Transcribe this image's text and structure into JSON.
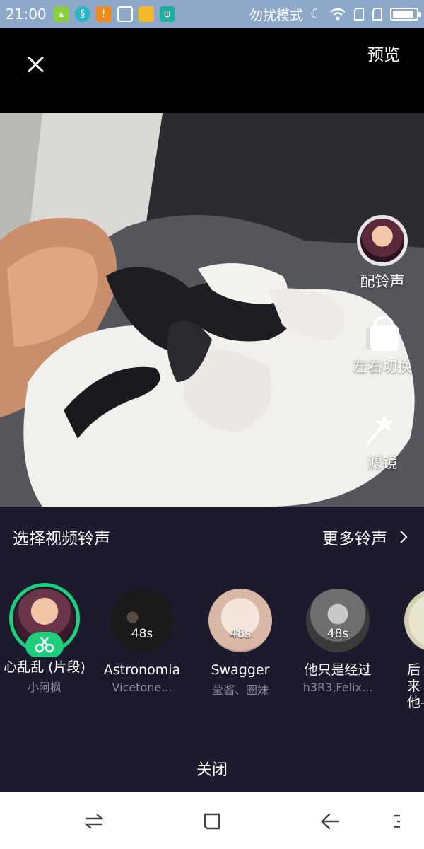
{
  "status_bar": {
    "time": "21:00",
    "mode_text": "勿扰模式",
    "battery_level": 0.92,
    "icons": [
      "notification-icon",
      "app-icon",
      "warning-icon",
      "clean-icon",
      "folder-icon",
      "usb-icon",
      "moon-icon",
      "wifi-icon",
      "sim1-icon",
      "sim2-icon",
      "battery-icon"
    ]
  },
  "top": {
    "close_icon": "close-icon",
    "preview_label": "预览"
  },
  "side_controls": {
    "ringtone_label": "配铃声",
    "switch_label": "左右切换",
    "filter_label": "滤镜"
  },
  "panel": {
    "title": "选择视频铃声",
    "more_label": "更多铃声",
    "close_label": "关闭",
    "accent": "#1fce7d",
    "songs": [
      {
        "name": "心乱乱 (片段)",
        "artist": "小阿枫",
        "duration": "",
        "selected": true
      },
      {
        "name": "Astronomia",
        "artist": "Vicetone...",
        "duration": "48s",
        "selected": false
      },
      {
        "name": "Swagger",
        "artist": "莹酱、圈妹",
        "duration": "48s",
        "selected": false
      },
      {
        "name": "他只是经过",
        "artist": "h3R3,Felix...",
        "duration": "48s",
        "selected": false
      },
      {
        "name": "后来他-",
        "artist": "",
        "duration": "",
        "selected": false
      }
    ]
  },
  "nav": {
    "icons": [
      "switch-apps-icon",
      "home-icon",
      "back-icon",
      "menu-icon"
    ]
  }
}
